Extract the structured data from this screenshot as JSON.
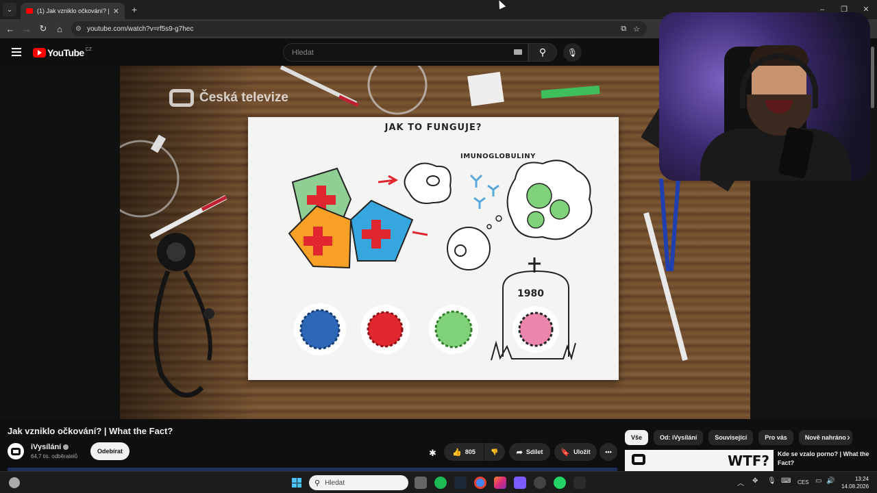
{
  "browser": {
    "tab_title": "(1) Jak vzniklo očkování? | What",
    "url": "youtube.com/watch?v=rf5s9-g7hec"
  },
  "youtube": {
    "logo_text": "YouTube",
    "country_code": "CZ",
    "search_placeholder": "Hledat"
  },
  "video": {
    "overlay_logo": "Česká televize",
    "paper_title": "JAK TO FUNGUJE?",
    "paper_label": "IMUNOGLOBULINY",
    "paper_year": "1980"
  },
  "info": {
    "title": "Jak vzniklo očkování? | What the Fact?",
    "channel_name": "iVysílání",
    "subscribers": "64,7 tis. odběratelů",
    "subscribe_label": "Odebírat",
    "likes": "805",
    "share_label": "Sdílet",
    "save_label": "Uložit"
  },
  "sidebar": {
    "chips": [
      "Vše",
      "Od: iVysílání",
      "Související",
      "Pro vás",
      "Nově nahráno"
    ],
    "rec_title": "Kde se vzalo porno? | What the Fact?",
    "rec_thumb_text": "WTF?"
  },
  "taskbar": {
    "search_placeholder": "Hledat",
    "language": "CES",
    "time": "13:24",
    "date": "14.08.2026"
  },
  "colors": {
    "youtube_red": "#ff0000",
    "windows_accent": "#4cc2ff",
    "progress_bar": "#1d2f5a"
  }
}
